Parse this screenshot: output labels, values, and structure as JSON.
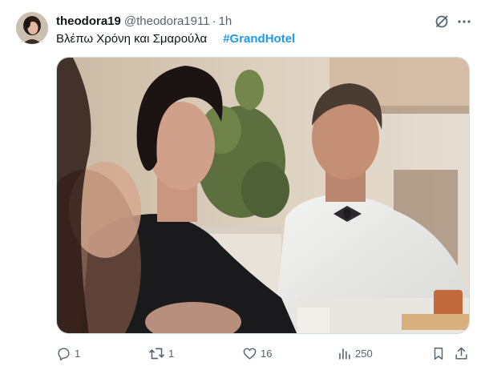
{
  "tweet": {
    "display_name": "theodora19",
    "handle": "@theodora1911",
    "separator": "·",
    "time": "1h",
    "text": "Βλέπω Χρόνη και Σμαρούλα",
    "hashtag": "#GrandHotel"
  },
  "actions": {
    "replies": "1",
    "retweets": "1",
    "likes": "16",
    "views": "250"
  },
  "colors": {
    "text": "#0f1419",
    "secondary": "#536471",
    "accent": "#1d9bf0",
    "border": "#cfd9de"
  },
  "icons": [
    "avatar",
    "grok-icon",
    "more-icon",
    "reply-icon",
    "retweet-icon",
    "like-icon",
    "views-icon",
    "bookmark-icon",
    "share-icon"
  ]
}
